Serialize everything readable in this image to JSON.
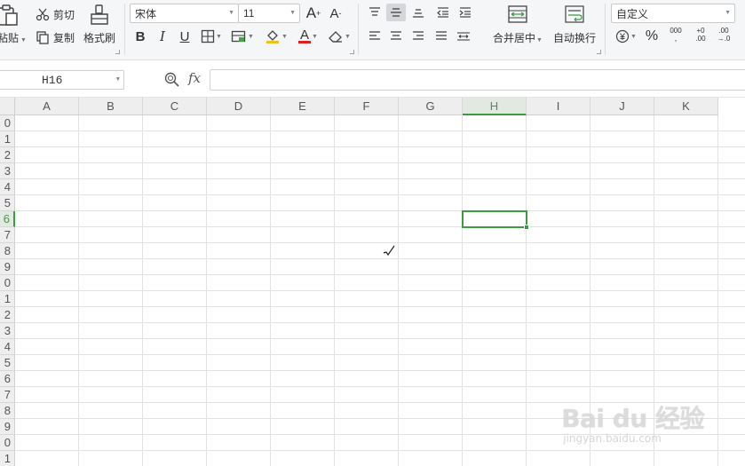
{
  "clipboard": {
    "paste_label": "粘贴",
    "cut_label": "剪切",
    "copy_label": "复制",
    "format_painter_label": "格式刷"
  },
  "font": {
    "family_value": "宋体",
    "size_value": "11",
    "bold_label": "B",
    "italic_label": "I",
    "underline_label": "U",
    "font_color_label": "A",
    "increase_label": "A",
    "decrease_label": "A",
    "increase_sup": "+",
    "decrease_sup": "-",
    "font_color_accent": "#e02020",
    "fill_color_accent": "#f0c020"
  },
  "alignment": {
    "merge_center_label": "合并居中",
    "wrap_text_label": "自动换行"
  },
  "number": {
    "format_value": "自定义",
    "percent_label": "%",
    "thousands_label": "000",
    "inc_decimal_label": "+0\n.00",
    "dec_decimal_label": ".00\n→.0"
  },
  "formula_bar": {
    "name_box_value": "H16",
    "fx_label": "fx",
    "formula_value": ""
  },
  "grid": {
    "columns": [
      "A",
      "B",
      "C",
      "D",
      "E",
      "F",
      "G",
      "H",
      "I",
      "J",
      "K"
    ],
    "active_column": "H",
    "row_labels": [
      "0",
      "1",
      "2",
      "3",
      "4",
      "5",
      "6",
      "7",
      "8",
      "9",
      "0",
      "1",
      "2",
      "3",
      "4",
      "5",
      "6",
      "7",
      "8",
      "9",
      "0",
      "1"
    ],
    "active_row_label": "6",
    "selection_color": "#3e9a43"
  },
  "watermark": {
    "logo_text": "Bai du 经验",
    "url_text": "jingyan.baidu.com"
  }
}
